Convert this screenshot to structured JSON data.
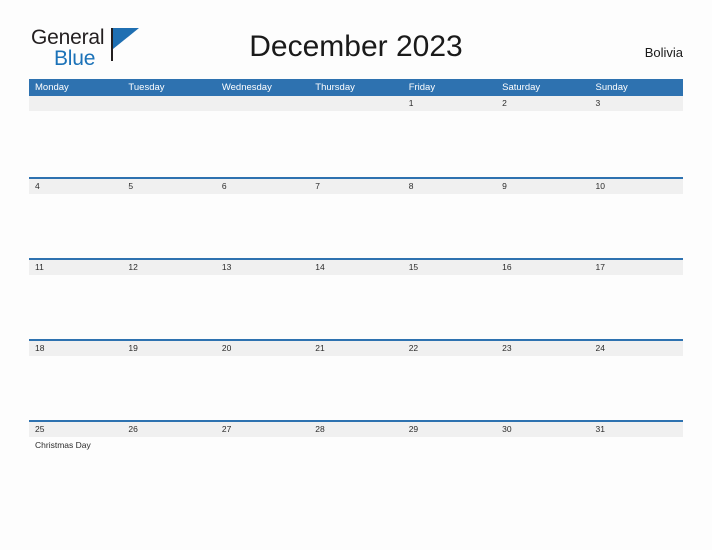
{
  "brand": {
    "name_part1": "General",
    "name_part2": "Blue",
    "flag_icon": "flag-icon"
  },
  "header": {
    "title": "December 2023",
    "country": "Bolivia"
  },
  "calendar": {
    "weekdays": [
      "Monday",
      "Tuesday",
      "Wednesday",
      "Thursday",
      "Friday",
      "Saturday",
      "Sunday"
    ],
    "colors": {
      "header_blue": "#2e72b0",
      "day_strip_gray": "#f0f0f0",
      "brand_blue": "#1b72b8",
      "text_dark": "#1a1a1a"
    },
    "weeks": [
      [
        {
          "date": "",
          "events": []
        },
        {
          "date": "",
          "events": []
        },
        {
          "date": "",
          "events": []
        },
        {
          "date": "",
          "events": []
        },
        {
          "date": "1",
          "events": []
        },
        {
          "date": "2",
          "events": []
        },
        {
          "date": "3",
          "events": []
        }
      ],
      [
        {
          "date": "4",
          "events": []
        },
        {
          "date": "5",
          "events": []
        },
        {
          "date": "6",
          "events": []
        },
        {
          "date": "7",
          "events": []
        },
        {
          "date": "8",
          "events": []
        },
        {
          "date": "9",
          "events": []
        },
        {
          "date": "10",
          "events": []
        }
      ],
      [
        {
          "date": "11",
          "events": []
        },
        {
          "date": "12",
          "events": []
        },
        {
          "date": "13",
          "events": []
        },
        {
          "date": "14",
          "events": []
        },
        {
          "date": "15",
          "events": []
        },
        {
          "date": "16",
          "events": []
        },
        {
          "date": "17",
          "events": []
        }
      ],
      [
        {
          "date": "18",
          "events": []
        },
        {
          "date": "19",
          "events": []
        },
        {
          "date": "20",
          "events": []
        },
        {
          "date": "21",
          "events": []
        },
        {
          "date": "22",
          "events": []
        },
        {
          "date": "23",
          "events": []
        },
        {
          "date": "24",
          "events": []
        }
      ],
      [
        {
          "date": "25",
          "events": [
            "Christmas Day"
          ]
        },
        {
          "date": "26",
          "events": []
        },
        {
          "date": "27",
          "events": []
        },
        {
          "date": "28",
          "events": []
        },
        {
          "date": "29",
          "events": []
        },
        {
          "date": "30",
          "events": []
        },
        {
          "date": "31",
          "events": []
        }
      ]
    ]
  }
}
